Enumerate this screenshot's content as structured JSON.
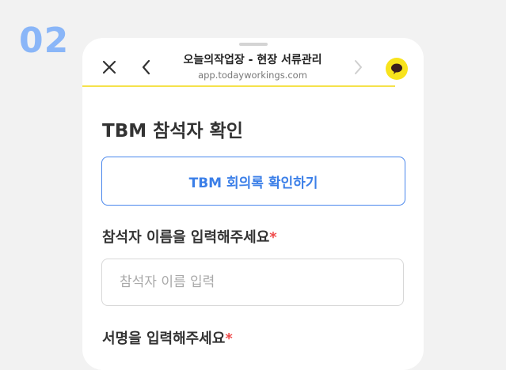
{
  "step": {
    "number": "02"
  },
  "browser": {
    "title": "오늘의작업장 - 현장 서류관리",
    "url": "app.todayworkings.com",
    "icons": [
      "close-icon",
      "back-icon",
      "forward-icon",
      "chat-bubble-icon"
    ]
  },
  "main": {
    "section_title": "TBM 참석자 확인",
    "minutes_button_label": "TBM 회의록 확인하기",
    "name_label": "참석자 이름을 입력해주세요",
    "name_placeholder": "참석자 이름 입력",
    "signature_label": "서명을 입력해주세요",
    "required_mark": "*"
  },
  "colors": {
    "step_number": "#8ab6f8",
    "accent_blue": "#3b7fe8",
    "required": "#ef4a4a",
    "kakao_yellow": "#f8e31c",
    "header_underline": "#f5e24b"
  }
}
